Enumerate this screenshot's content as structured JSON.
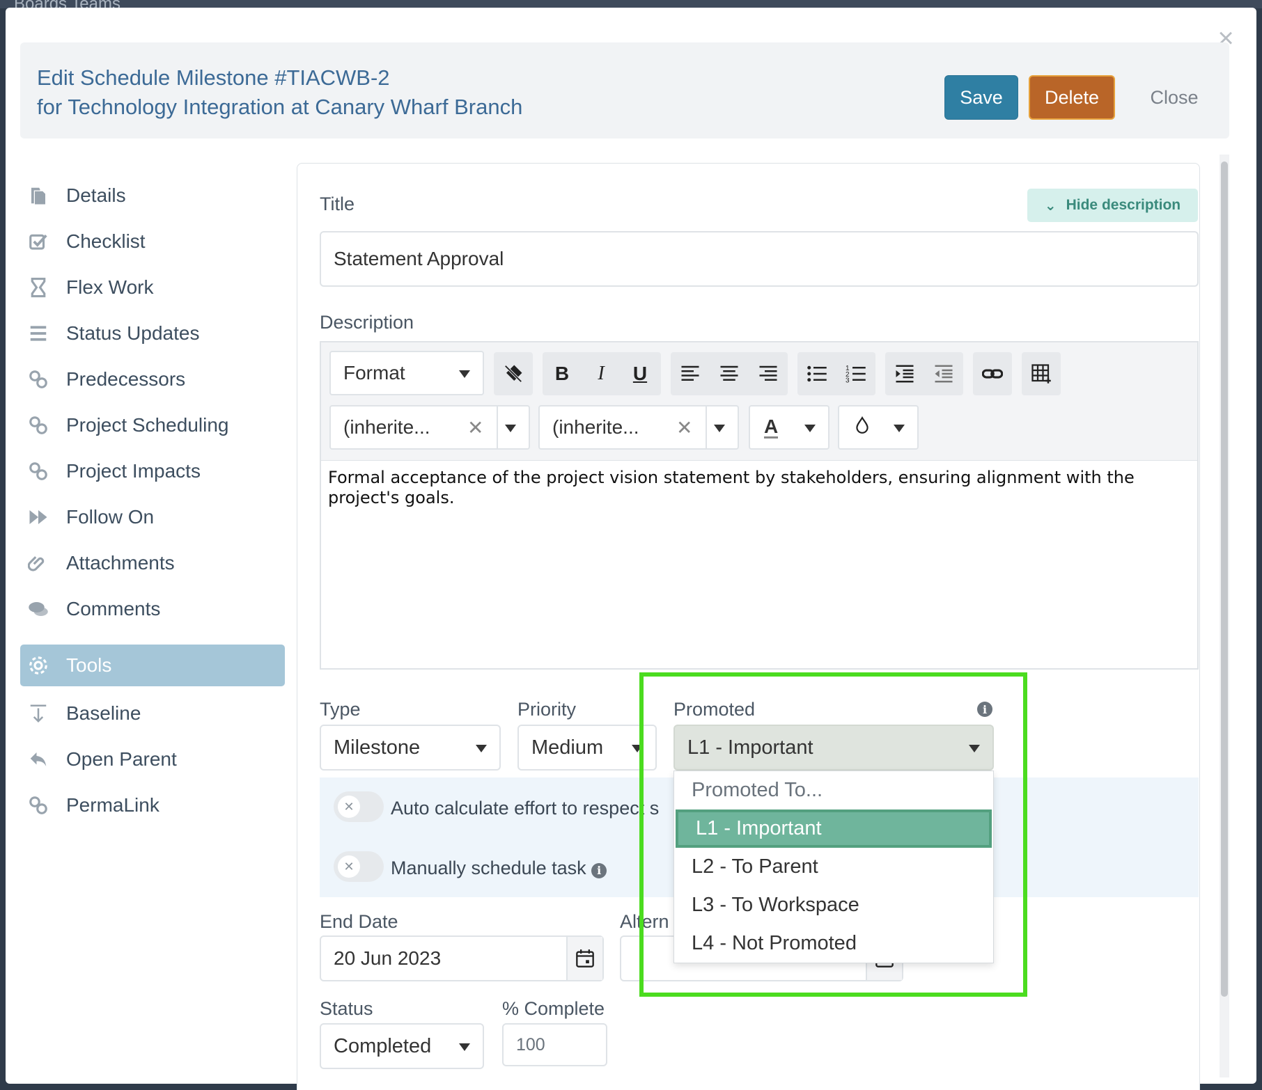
{
  "background": {
    "text": "Boards       Teams"
  },
  "modal": {
    "title_line1": "Edit Schedule Milestone #TIACWB-2",
    "title_line2": "for Technology Integration at Canary Wharf Branch",
    "save_label": "Save",
    "delete_label": "Delete",
    "close_label": "Close",
    "close_icon": "×"
  },
  "sidebar": {
    "items": [
      {
        "label": "Details",
        "icon": "document-icon"
      },
      {
        "label": "Checklist",
        "icon": "checkbox-icon"
      },
      {
        "label": "Flex Work",
        "icon": "hourglass-icon"
      },
      {
        "label": "Status Updates",
        "icon": "list-icon"
      },
      {
        "label": "Predecessors",
        "icon": "link-icon"
      },
      {
        "label": "Project Scheduling",
        "icon": "link-icon"
      },
      {
        "label": "Project Impacts",
        "icon": "link-icon"
      },
      {
        "label": "Follow On",
        "icon": "fast-forward-icon"
      },
      {
        "label": "Attachments",
        "icon": "paperclip-icon"
      },
      {
        "label": "Comments",
        "icon": "comments-icon"
      }
    ],
    "tools_label": "Tools",
    "tools_items": [
      {
        "label": "Baseline",
        "icon": "baseline-icon"
      },
      {
        "label": "Open Parent",
        "icon": "reply-icon"
      },
      {
        "label": "PermaLink",
        "icon": "link-icon"
      }
    ]
  },
  "form": {
    "title_label": "Title",
    "title_value": "Statement Approval",
    "hide_description_label": "Hide description",
    "description_label": "Description",
    "editor": {
      "format_label": "Format",
      "font_family_value": "(inherite...",
      "font_size_value": "(inherite...",
      "text_color_glyph": "A"
    },
    "description_text": "Formal acceptance of the project vision statement by stakeholders, ensuring alignment with the project's goals.",
    "type_label": "Type",
    "type_value": "Milestone",
    "priority_label": "Priority",
    "priority_value": "Medium",
    "promoted_label": "Promoted",
    "promoted_value": "L1 - Important",
    "promoted_options": [
      "Promoted To...",
      "L1 - Important",
      "L2 - To Parent",
      "L3 - To Workspace",
      "L4 - Not Promoted"
    ],
    "auto_calc_label": "Auto calculate effort to respect s",
    "manual_schedule_label": "Manually schedule task",
    "end_date_label": "End Date",
    "end_date_value": "20 Jun 2023",
    "alt_label": "Altern",
    "status_label": "Status",
    "status_value": "Completed",
    "percent_label": "% Complete",
    "percent_value": "100"
  },
  "colors": {
    "accent_title": "#3c6a96",
    "save": "#2f7fa3",
    "delete": "#b96528",
    "selected_option": "#6fb59c",
    "highlight_box": "#4bdc1f"
  }
}
